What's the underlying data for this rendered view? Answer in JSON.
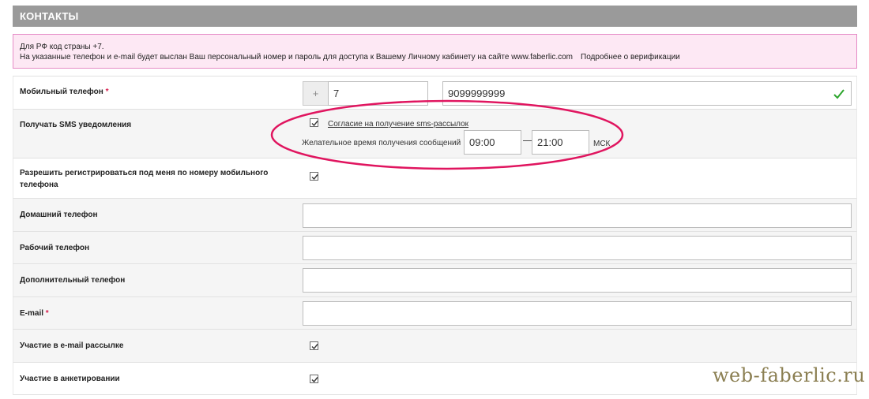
{
  "section": {
    "title": "КОНТАКТЫ"
  },
  "notice": {
    "line1": "Для РФ код страны +7.",
    "line2": "На указанные телефон и e-mail будет выслан Ваш персональный номер и пароль для доступа к Вашему Личному кабинету на сайте www.faberlic.com",
    "more_link": "Подробнее о верификации"
  },
  "mobile": {
    "label": "Мобильный телефон",
    "required_mark": "*",
    "plus": "+",
    "country_code": "7",
    "number": "9099999999"
  },
  "sms": {
    "label": "Получать SMS уведомления",
    "consent_label": "Согласие на получение sms-рассылок",
    "consent_checked": true,
    "time_label": "Желательное время получения сообщений",
    "time_from": "09:00",
    "dash": "—",
    "time_to": "21:00",
    "timezone": "МСК"
  },
  "allow_register": {
    "label": "Разрешить регистрироваться под меня по номеру мобильного телефона",
    "checked": true
  },
  "home_phone": {
    "label": "Домашний телефон",
    "value": ""
  },
  "work_phone": {
    "label": "Рабочий телефон",
    "value": ""
  },
  "extra_phone": {
    "label": "Дополнительный телефон",
    "value": ""
  },
  "email": {
    "label": "E-mail",
    "required_mark": "*",
    "value": ""
  },
  "email_newsletter": {
    "label": "Участие в e-mail рассылке",
    "checked": true
  },
  "surveys": {
    "label": "Участие в анкетировании",
    "checked": true
  },
  "watermark": "web-faberlic.ru",
  "colors": {
    "header_bg": "#9a9a9a",
    "notice_bg": "#fde8f4",
    "notice_border": "#e58bc6",
    "highlight_ellipse": "#e0155f",
    "valid_check": "#2ca52c"
  }
}
